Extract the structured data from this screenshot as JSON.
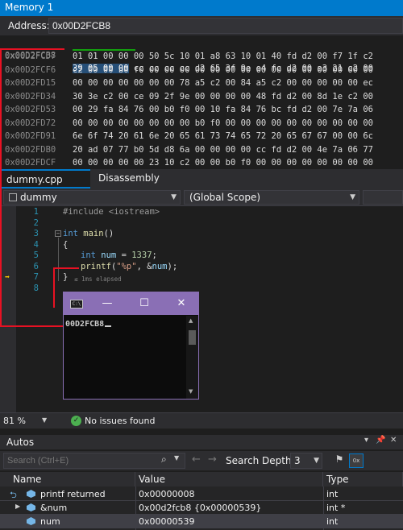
{
  "memory": {
    "title": "Memory 1",
    "address_label": "Address:",
    "address_value": "0x00D2FCB8",
    "rows": [
      {
        "addr": "0x00D2FCB8",
        "hl": "39 05 00 00",
        "bytes": " cc cc cc cc d2 65 3f 9e e4 fc d2 00 a3 21 c2 00"
      },
      {
        "addr": "0x00D2FCD7",
        "hl": "",
        "bytes": "01 01 00 00 00 50 5c 10 01 a8 63 10 01 40 fd d2 00 f7 1f c2"
      },
      {
        "addr": "0x00D2FCF6",
        "hl": "",
        "bytes": "c2 00 00 b0 f0 00 00 00 00 00 00 00 00 00 00 00 00 00 00 00"
      },
      {
        "addr": "0x00D2FD15",
        "hl": "",
        "bytes": "00 00 00 00 00 00 00 78 a5 c2 00 84 a5 c2 00 00 00 00 00 ec"
      },
      {
        "addr": "0x00D2FD34",
        "hl": "",
        "bytes": "30 3e c2 00 ce 09 2f 9e 00 00 00 00 48 fd d2 00 8d 1e c2 00"
      },
      {
        "addr": "0x00D2FD53",
        "hl": "",
        "bytes": "00 29 fa 84 76 00 b0 f0 00 10 fa 84 76 bc fd d2 00 7e 7a 06"
      },
      {
        "addr": "0x00D2FD72",
        "hl": "",
        "bytes": "00 00 00 00 00 00 00 00 b0 f0 00 00 00 00 00 00 00 00 00 00"
      },
      {
        "addr": "0x00D2FD91",
        "hl": "",
        "bytes": "6e 6f 74 20 61 6e 20 65 61 73 74 65 72 20 65 67 67 00 00 6c"
      },
      {
        "addr": "0x00D2FDB0",
        "hl": "",
        "bytes": "20 ad 07 77 b0 5d d8 6a 00 00 00 00 cc fd d2 00 4e 7a 06 77"
      },
      {
        "addr": "0x00D2FDCF",
        "hl": "",
        "bytes": "00 00 00 00 00 23 10 c2 00 00 b0 f0 00 00 00 00 00 00 00 00"
      }
    ]
  },
  "editor": {
    "tabs": [
      "dummy.cpp",
      "Disassembly"
    ],
    "project_dropdown": "dummy",
    "scope_dropdown": "(Global Scope)",
    "line_numbers": [
      "1",
      "2",
      "3",
      "4",
      "5",
      "6",
      "7",
      "8"
    ],
    "code": {
      "l1_pp": "#include <iostream>",
      "l3_kw": "int",
      "l3_fn": " main",
      "l3_rest": "()",
      "l4": "{",
      "l5_kw": "int",
      "l5_var": " num",
      "l5_rest": " = ",
      "l5_num": "1337",
      "l5_end": ";",
      "l6_fn": "printf",
      "l6_a": "(",
      "l6_str": "\"%p\"",
      "l6_b": ", &",
      "l6_var": "num",
      "l6_c": ");",
      "l7": "}"
    },
    "elapsed": "≤ 1ms elapsed"
  },
  "console": {
    "icon_text": "C:\\",
    "output": "00D2FCB8"
  },
  "status": {
    "zoom": "81 %",
    "issues": "No issues found"
  },
  "autos": {
    "title": "Autos",
    "search_placeholder": "Search (Ctrl+E)",
    "depth_label": "Search Depth:",
    "depth_value": "3",
    "hex_label": "0x",
    "columns": [
      "Name",
      "Value",
      "Type"
    ],
    "rows": [
      {
        "name": "printf returned",
        "value": "0x00000008",
        "type": "int"
      },
      {
        "name": "&num",
        "value": "0x00d2fcb8 {0x00000539}",
        "type": "int *"
      },
      {
        "name": "num",
        "value": "0x00000539",
        "type": "int"
      }
    ]
  },
  "colors": {
    "accent": "#007acc",
    "console_title": "#8a6fb5",
    "annotation": "#e81123",
    "highlight_underline": "#13a10e"
  }
}
